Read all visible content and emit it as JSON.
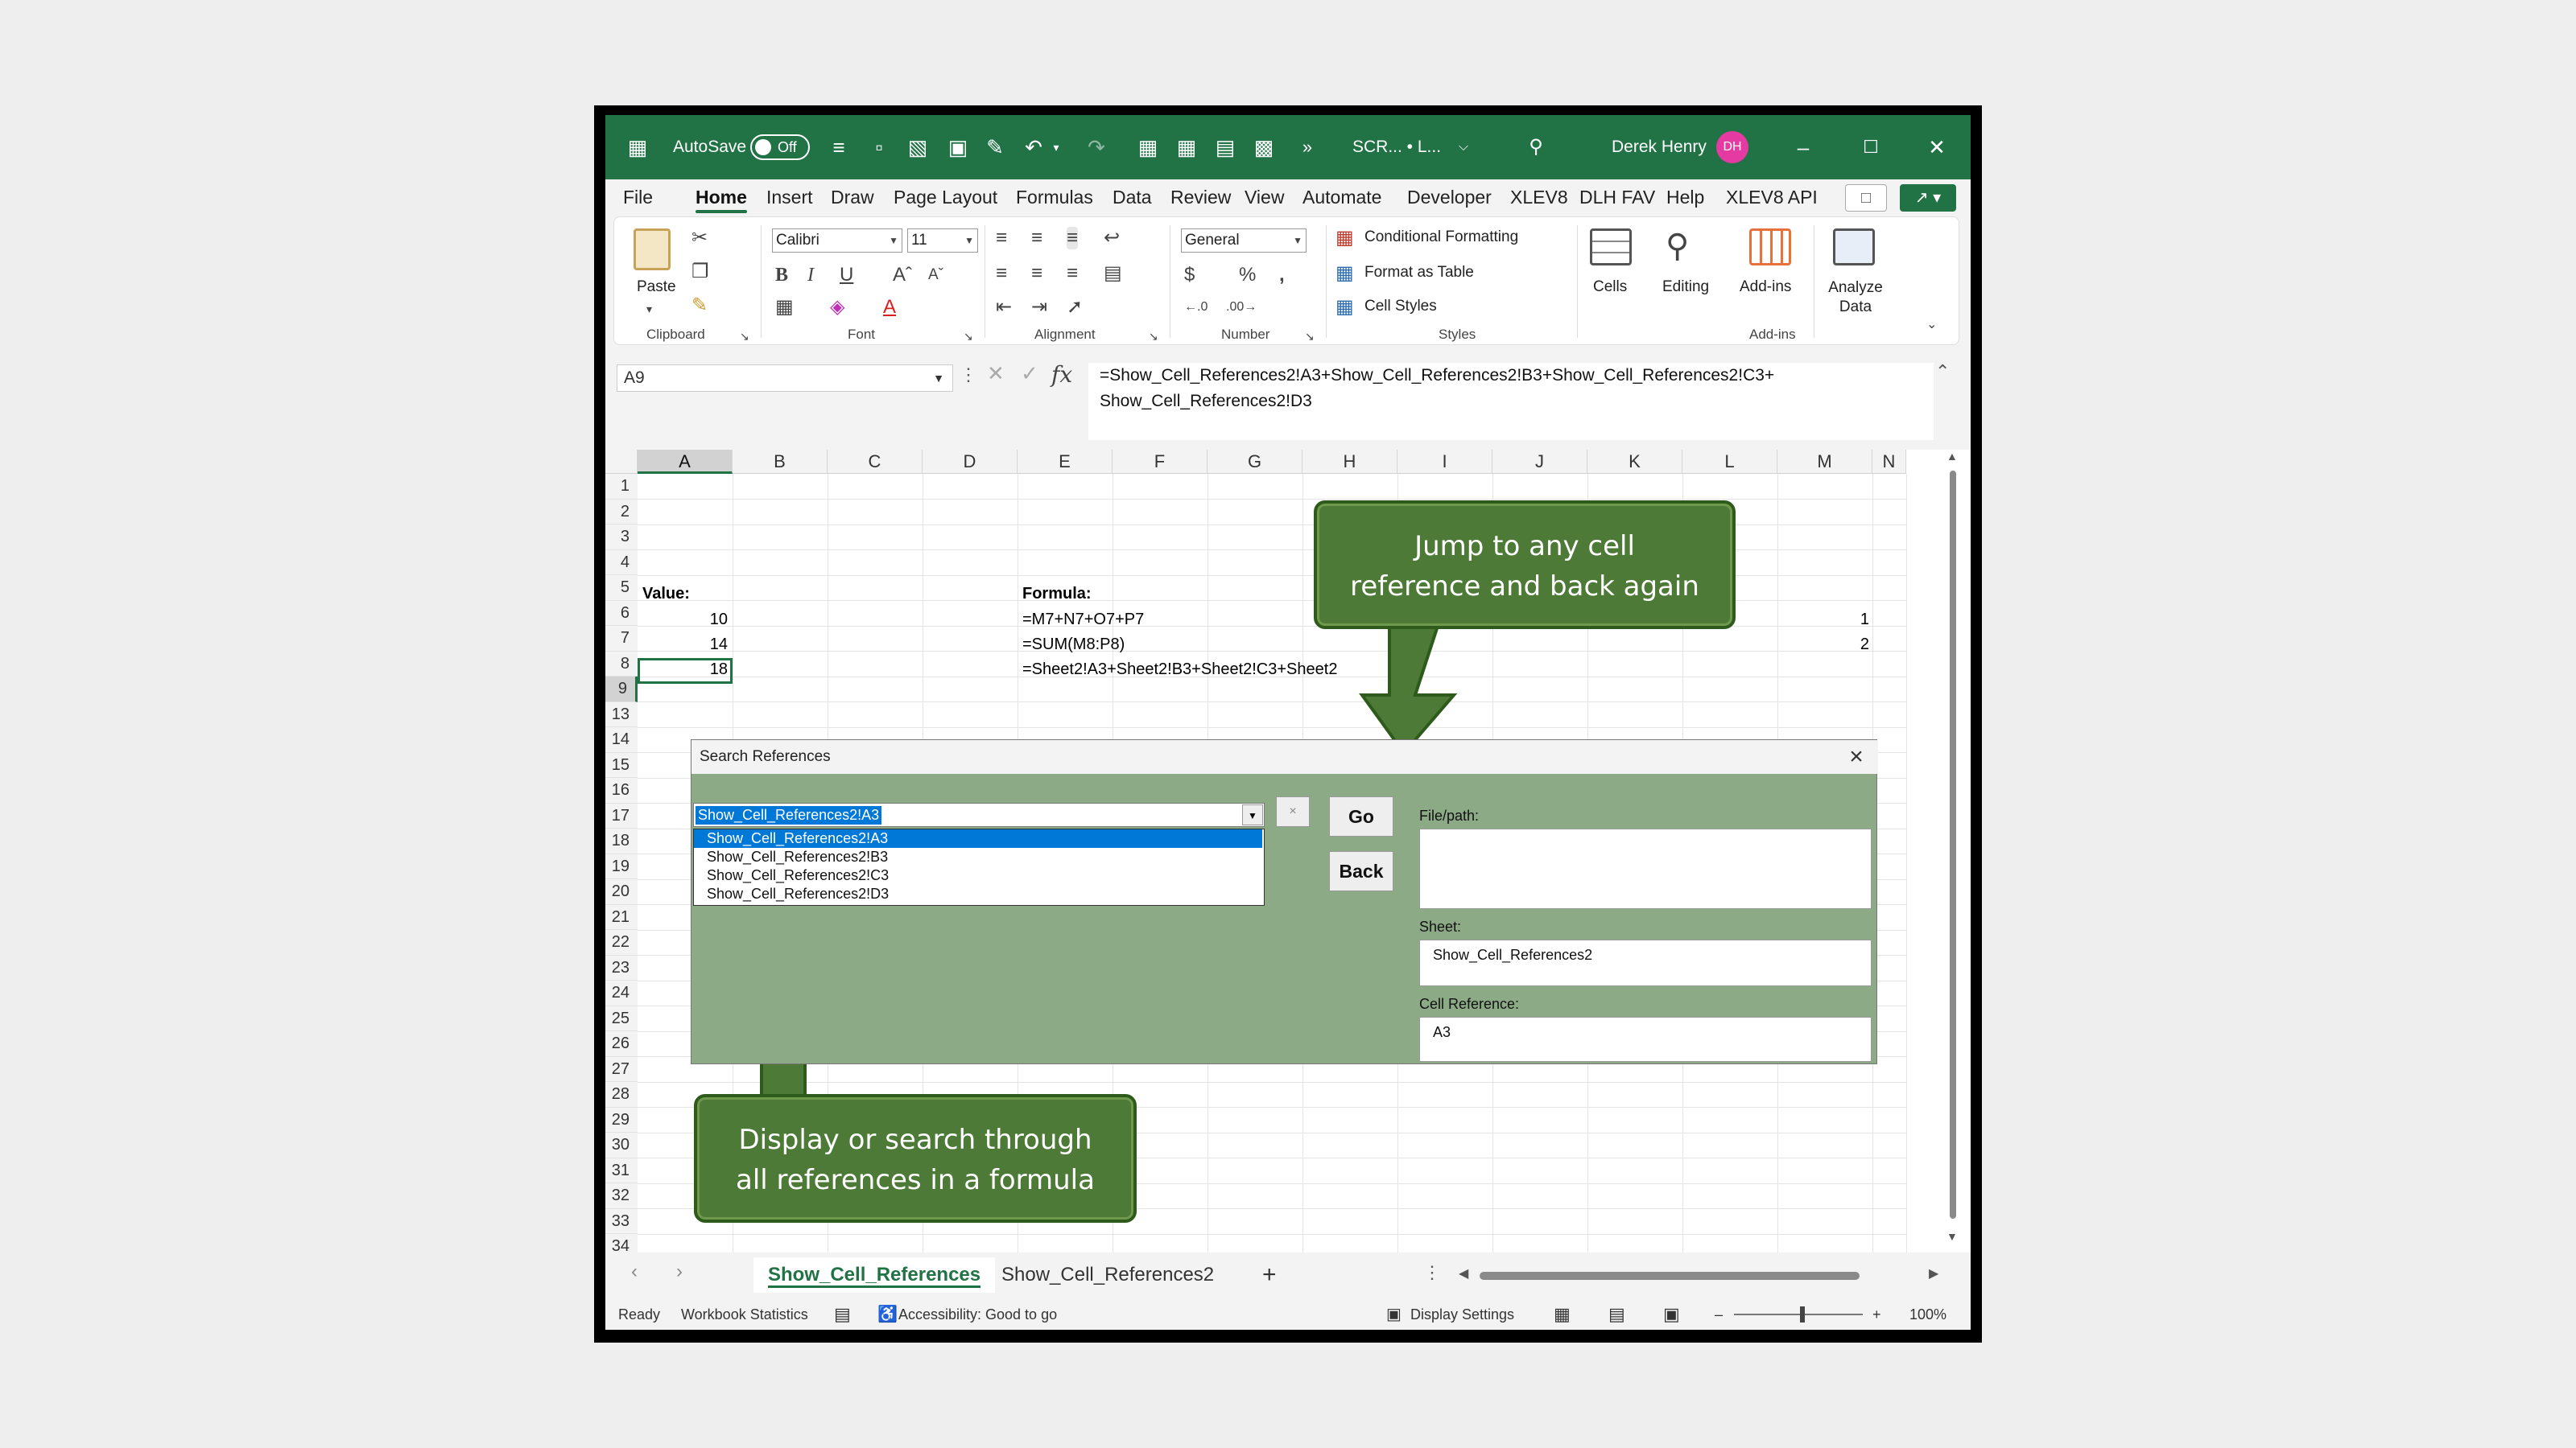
{
  "titlebar": {
    "autosave_label": "AutoSave",
    "autosave_state": "Off",
    "filename": "SCR... • L...",
    "user_name": "Derek Henry",
    "user_initials": "DH"
  },
  "menu": {
    "items": [
      "File",
      "Home",
      "Insert",
      "Draw",
      "Page Layout",
      "Formulas",
      "Data",
      "Review",
      "View",
      "Automate",
      "Developer",
      "XLEV8",
      "DLH FAV",
      "Help",
      "XLEV8 API"
    ],
    "active": "Home"
  },
  "ribbon": {
    "clipboard": {
      "paste": "Paste",
      "group": "Clipboard"
    },
    "font": {
      "name": "Calibri",
      "size": "11",
      "group": "Font"
    },
    "alignment": {
      "group": "Alignment"
    },
    "number": {
      "format": "General",
      "group": "Number"
    },
    "styles": {
      "conditional": "Conditional Formatting",
      "table": "Format as Table",
      "cell": "Cell Styles",
      "group": "Styles"
    },
    "cells": "Cells",
    "editing": "Editing",
    "addins": "Add-ins",
    "analyze": "Analyze Data",
    "addins_group": "Add-ins"
  },
  "formula_bar": {
    "name_box": "A9",
    "fx": "fx",
    "formula": "=Show_Cell_References2!A3+Show_Cell_References2!B3+Show_Cell_References2!C3+\nShow_Cell_References2!D3"
  },
  "grid": {
    "columns": [
      "A",
      "B",
      "C",
      "D",
      "E",
      "F",
      "G",
      "H",
      "I",
      "J",
      "K",
      "L",
      "M",
      "N"
    ],
    "rows": [
      "1",
      "2",
      "3",
      "4",
      "5",
      "6",
      "7",
      "8",
      "9",
      "13",
      "14",
      "15",
      "16",
      "17",
      "18",
      "19",
      "20",
      "21",
      "22",
      "23",
      "24",
      "25",
      "26",
      "27",
      "28",
      "29",
      "30",
      "31",
      "32",
      "33",
      "34"
    ],
    "value_label": "Value:",
    "formula_label": "Formula:",
    "values": [
      "10",
      "14",
      "18"
    ],
    "formulas": [
      "=M7+N7+O7+P7",
      "=SUM(M8:P8)",
      "=Sheet2!A3+Sheet2!B3+Sheet2!C3+Sheet2"
    ],
    "m_values": [
      "1",
      "2"
    ],
    "selected_cell": "A9"
  },
  "callouts": {
    "jump": "Jump to any cell\nreference  and back again",
    "display": "Display or search through\nall references  in a formula"
  },
  "dialog": {
    "title": "Search References",
    "combo_value": "Show_Cell_References2!A3",
    "list": [
      "Show_Cell_References2!A3",
      "Show_Cell_References2!B3",
      "Show_Cell_References2!C3",
      "Show_Cell_References2!D3"
    ],
    "clear_label": "×",
    "go": "Go",
    "back": "Back",
    "file_path_label": "File/path:",
    "file_path_value": "",
    "sheet_label": "Sheet:",
    "sheet_value": "Show_Cell_References2",
    "cellref_label": "Cell Reference:",
    "cellref_value": "A3"
  },
  "tabs": {
    "sheets": [
      "Show_Cell_References",
      "Show_Cell_References2"
    ],
    "active": "Show_Cell_References",
    "add": "+"
  },
  "status": {
    "ready": "Ready",
    "workbook_stats": "Workbook Statistics",
    "accessibility": "Accessibility: Good to go",
    "display_settings": "Display Settings",
    "zoom": "100%"
  },
  "colors": {
    "accent": "#217346",
    "callout": "#4d7a36",
    "dialog": "#8caa86",
    "selection": "#0078d7"
  }
}
